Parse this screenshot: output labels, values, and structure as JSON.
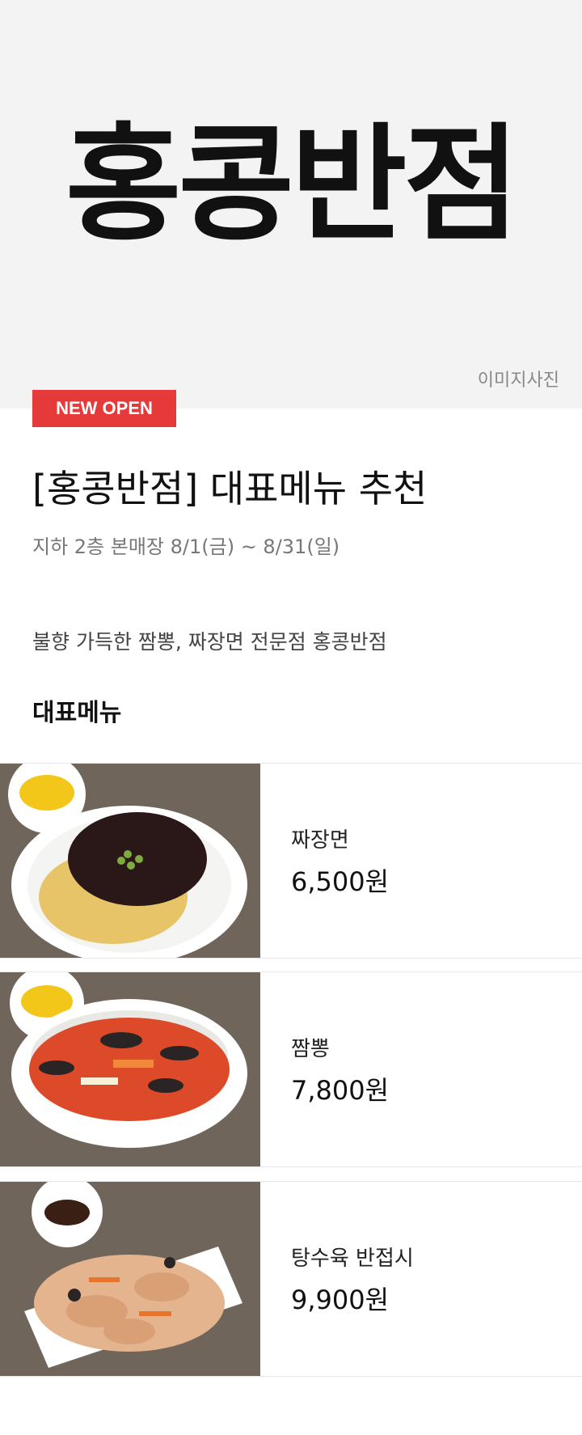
{
  "hero": {
    "logo_text": "홍콩반점",
    "caption": "이미지사진"
  },
  "badge": "NEW OPEN",
  "title": "[홍콩반점] 대표메뉴 추천",
  "subtitle": "지하 2층 본매장 8/1(금) ~ 8/31(일)",
  "description": "불향 가득한 짬뽕, 짜장면 전문점 홍콩반점",
  "section_title": "대표메뉴",
  "menu": [
    {
      "name": "짜장면",
      "price": "6,500원"
    },
    {
      "name": "짬뽕",
      "price": "7,800원"
    },
    {
      "name": "탕수육 반접시",
      "price": "9,900원"
    }
  ],
  "colors": {
    "badge_bg": "#e63a3a",
    "hero_bg": "#f3f3f3"
  }
}
